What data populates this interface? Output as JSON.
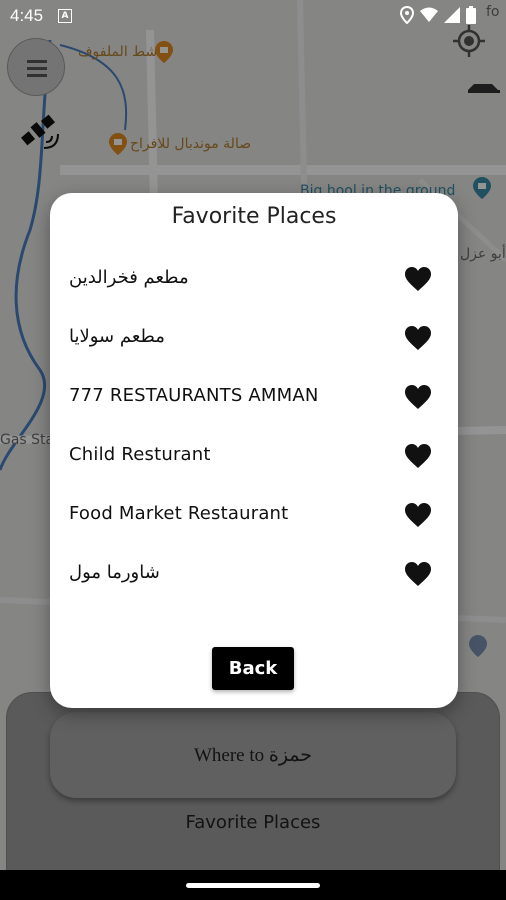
{
  "status_bar": {
    "time": "4:45",
    "notification_glyph": "A"
  },
  "map": {
    "labels": [
      {
        "id": "cafe",
        "text": "شط الملفوف"
      },
      {
        "id": "hall",
        "text": "صالة موندبال للافراح"
      },
      {
        "id": "bighole",
        "text": "Big hool in the ground"
      },
      {
        "id": "abu",
        "text": "أبو عزل"
      },
      {
        "id": "gas",
        "text": "Gas Sta"
      },
      {
        "id": "fo",
        "text": "fo"
      }
    ]
  },
  "dialog": {
    "title": "Favorite Places",
    "places": [
      {
        "name": "مطعم فخرالدين"
      },
      {
        "name": "مطعم سولايا"
      },
      {
        "name": "777 RESTAURANTS AMMAN"
      },
      {
        "name": "Child Resturant"
      },
      {
        "name": "Food Market Restaurant"
      },
      {
        "name": "شاورما مول"
      }
    ],
    "back_label": "Back"
  },
  "bottom_panel": {
    "where_to_label": "Where to حمزة",
    "favorite_places_label": "Favorite Places"
  }
}
